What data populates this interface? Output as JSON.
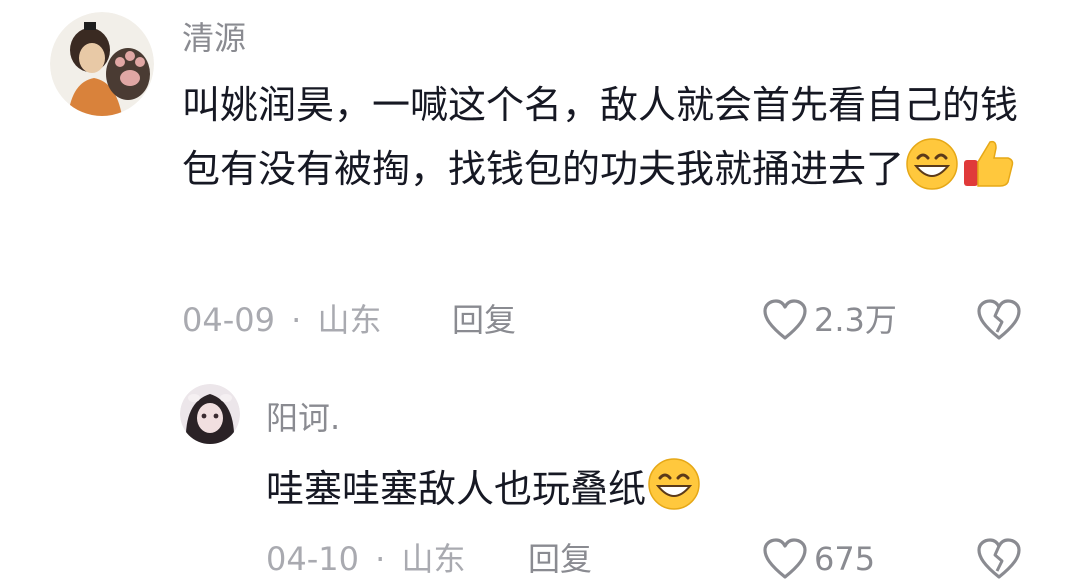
{
  "comment": {
    "username": "清源",
    "text": "叫姚润昊，一喊这个名，敌人就会首先看自己的钱包有没有被掏，找钱包的功夫我就捅进去了",
    "emojis": [
      "grin-emoji",
      "thumbs-up-emoji"
    ],
    "date": "04-09",
    "separator": "·",
    "location": "山东",
    "reply_label": "回复",
    "likes": "2.3万"
  },
  "reply": {
    "username": "阳诃.",
    "text": "哇塞哇塞敌人也玩叠纸",
    "emojis": [
      "grin-emoji"
    ],
    "date": "04-10",
    "separator": "·",
    "location": "山东",
    "reply_label": "回复",
    "likes": "675"
  },
  "colors": {
    "text": "#161823",
    "username": "#8a8b91",
    "meta": "#a9aab0",
    "background": "#ffffff"
  }
}
